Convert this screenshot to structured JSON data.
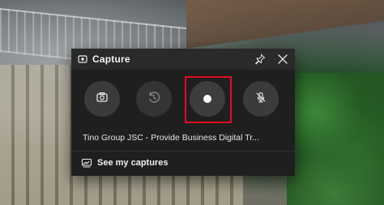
{
  "widget": {
    "title": "Capture",
    "icons": {
      "title": "capture-widget-icon",
      "pin": "pin-icon",
      "close": "close-icon",
      "screenshot": "camera-icon",
      "replay": "record-last-30-seconds-icon",
      "record": "start-recording-icon",
      "mic": "microphone-off-icon",
      "gallery": "gallery-icon"
    },
    "app_name": "Tino Group JSC - Provide Business Digital Tr...",
    "see_captures_label": "See my captures",
    "colors": {
      "panel_bg": "#1f1f1f",
      "titlebar_bg": "#2a2a2a",
      "button_bg": "#3b3b3b",
      "highlight": "#e10f1f",
      "text": "#f2f2f2"
    }
  }
}
